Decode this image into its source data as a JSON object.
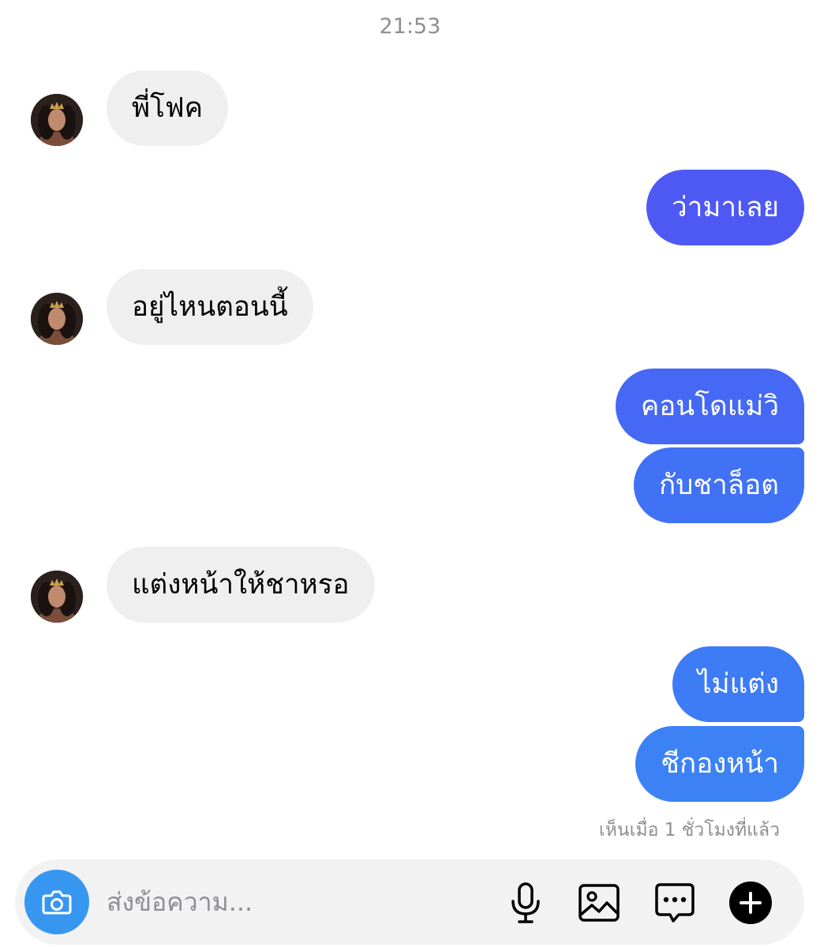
{
  "header": {
    "timestamp": "21:53"
  },
  "messages": [
    {
      "from": "them",
      "text": "พี่โฟค"
    },
    {
      "from": "me",
      "text": "ว่ามาเลย"
    },
    {
      "from": "them",
      "text": "อยู่ไหนตอนนี้"
    },
    {
      "from": "me",
      "text": "คอนโดแม่วิ"
    },
    {
      "from": "me",
      "text": "กับชาล็อต"
    },
    {
      "from": "them",
      "text": "แต่งหน้าให้ชาหรอ"
    },
    {
      "from": "me",
      "text": "ไม่แต่ง"
    },
    {
      "from": "me",
      "text": "ชีกองหน้า"
    }
  ],
  "seen_status": "เห็นเมื่อ 1 ชั่วโมงที่แล้ว",
  "composer": {
    "placeholder": "ส่งข้อความ...",
    "icons": [
      "camera-icon",
      "microphone-icon",
      "gallery-icon",
      "sticker-icon",
      "plus-icon"
    ]
  },
  "colors": {
    "incoming_bubble": "#efefef",
    "outgoing_gradient_top": "#5151f5",
    "outgoing_gradient_bottom": "#3e80f5",
    "camera_button": "#3797f0"
  }
}
